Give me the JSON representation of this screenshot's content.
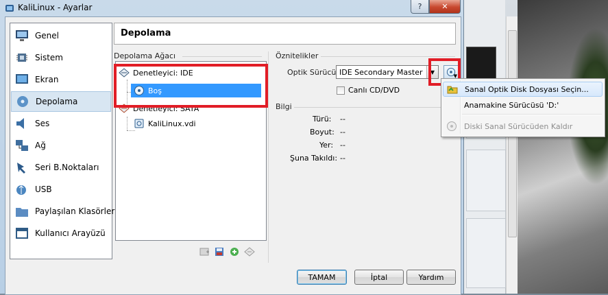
{
  "window": {
    "title": "KaliLinux - Ayarlar",
    "help_glyph": "?",
    "close_glyph": "✕"
  },
  "sidebar": {
    "items": [
      {
        "label": "Genel",
        "icon": "monitor-icon"
      },
      {
        "label": "Sistem",
        "icon": "chip-icon"
      },
      {
        "label": "Ekran",
        "icon": "display-icon"
      },
      {
        "label": "Depolama",
        "icon": "storage-disk-icon"
      },
      {
        "label": "Ses",
        "icon": "speaker-icon"
      },
      {
        "label": "Ağ",
        "icon": "network-icon"
      },
      {
        "label": "Seri B.Noktaları",
        "icon": "serial-port-icon"
      },
      {
        "label": "USB",
        "icon": "usb-icon"
      },
      {
        "label": "Paylaşılan Klasörler",
        "icon": "folder-icon"
      },
      {
        "label": "Kullanıcı Arayüzü",
        "icon": "window-icon"
      }
    ],
    "active_index": 3
  },
  "page": {
    "title": "Depolama"
  },
  "storage_tree": {
    "group_label": "Depolama Ağacı",
    "controller_ide": "Denetleyici: IDE",
    "ide_child": "Boş",
    "controller_sata": "Denetleyici: SATA",
    "sata_child": "KaliLinux.vdi"
  },
  "attributes": {
    "group_label": "Öznitelikler",
    "optical_drive_label": "Optik Sürücü:",
    "optical_drive_value": "IDE Secondary Master",
    "live_cd_label": "Canlı CD/DVD",
    "live_cd_checked": false
  },
  "info": {
    "group_label": "Bilgi",
    "rows": [
      {
        "label": "Türü:",
        "value": "--"
      },
      {
        "label": "Boyut:",
        "value": "--"
      },
      {
        "label": "Yer:",
        "value": "--"
      },
      {
        "label": "Şuna Takıldı:",
        "value": "--"
      }
    ]
  },
  "buttons": {
    "ok": "TAMAM",
    "cancel": "İptal",
    "help": "Yardım"
  },
  "menu": {
    "items": [
      {
        "label": "Sanal Optik Disk Dosyası Seçin...",
        "icon": "folder-open-icon",
        "highlighted": true,
        "enabled": true
      },
      {
        "label": "Anamakine Sürücüsü 'D:'",
        "icon": "",
        "highlighted": false,
        "enabled": true
      },
      {
        "label": "Diski Sanal Sürücüden Kaldır",
        "icon": "remove-disk-icon",
        "highlighted": false,
        "enabled": false
      }
    ]
  },
  "colors": {
    "annotation_red": "#e11d26",
    "selection_blue": "#3399ff",
    "active_side": "#d8e6f2"
  }
}
